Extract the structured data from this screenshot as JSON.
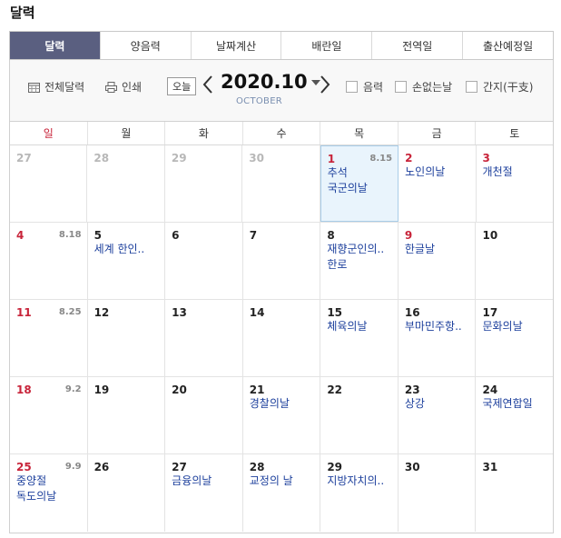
{
  "page_title": "달력",
  "tabs": [
    {
      "label": "달력",
      "active": true
    },
    {
      "label": "양음력"
    },
    {
      "label": "날짜계산"
    },
    {
      "label": "배란일"
    },
    {
      "label": "전역일"
    },
    {
      "label": "출산예정일"
    }
  ],
  "toolbar": {
    "full_calendar": "전체달력",
    "print": "인쇄",
    "today": "오늘",
    "year_month": "2020.10",
    "month_en": "OCTOBER",
    "lunar_check": "음력",
    "no_son_check": "손없는날",
    "ganji_check": "간지(干支)"
  },
  "weekdays": [
    "일",
    "월",
    "화",
    "수",
    "목",
    "금",
    "토"
  ],
  "weeks": [
    [
      {
        "day": "27",
        "other": true
      },
      {
        "day": "28",
        "other": true
      },
      {
        "day": "29",
        "other": true
      },
      {
        "day": "30",
        "other": true
      },
      {
        "day": "1",
        "lunar": "8.15",
        "events": [
          "추석",
          "국군의날"
        ],
        "holiday": true,
        "today": true
      },
      {
        "day": "2",
        "events": [
          "노인의날"
        ],
        "holiday": true
      },
      {
        "day": "3",
        "events": [
          "개천절"
        ],
        "holiday": true
      }
    ],
    [
      {
        "day": "4",
        "lunar": "8.18",
        "sun": true
      },
      {
        "day": "5",
        "events": [
          "세계 한인.."
        ]
      },
      {
        "day": "6"
      },
      {
        "day": "7"
      },
      {
        "day": "8",
        "events": [
          "재향군인의..",
          "한로"
        ]
      },
      {
        "day": "9",
        "events": [
          "한글날"
        ],
        "holiday": true
      },
      {
        "day": "10"
      }
    ],
    [
      {
        "day": "11",
        "lunar": "8.25",
        "sun": true
      },
      {
        "day": "12"
      },
      {
        "day": "13"
      },
      {
        "day": "14"
      },
      {
        "day": "15",
        "events": [
          "체육의날"
        ]
      },
      {
        "day": "16",
        "events": [
          "부마민주항.."
        ]
      },
      {
        "day": "17",
        "events": [
          "문화의날"
        ]
      }
    ],
    [
      {
        "day": "18",
        "lunar": "9.2",
        "sun": true
      },
      {
        "day": "19"
      },
      {
        "day": "20"
      },
      {
        "day": "21",
        "events": [
          "경찰의날"
        ]
      },
      {
        "day": "22"
      },
      {
        "day": "23",
        "events": [
          "상강"
        ]
      },
      {
        "day": "24",
        "events": [
          "국제연합일"
        ]
      }
    ],
    [
      {
        "day": "25",
        "lunar": "9.9",
        "events": [
          "중양절",
          "독도의날"
        ],
        "sun": true
      },
      {
        "day": "26"
      },
      {
        "day": "27",
        "events": [
          "금융의날"
        ]
      },
      {
        "day": "28",
        "events": [
          "교정의 날"
        ]
      },
      {
        "day": "29",
        "events": [
          "지방자치의.."
        ]
      },
      {
        "day": "30"
      },
      {
        "day": "31"
      }
    ]
  ],
  "colors": {
    "accent_tab": "#5a5f80",
    "holiday": "#c8243a",
    "event": "#1c3f9c",
    "today_bg": "#e9f4fc"
  }
}
